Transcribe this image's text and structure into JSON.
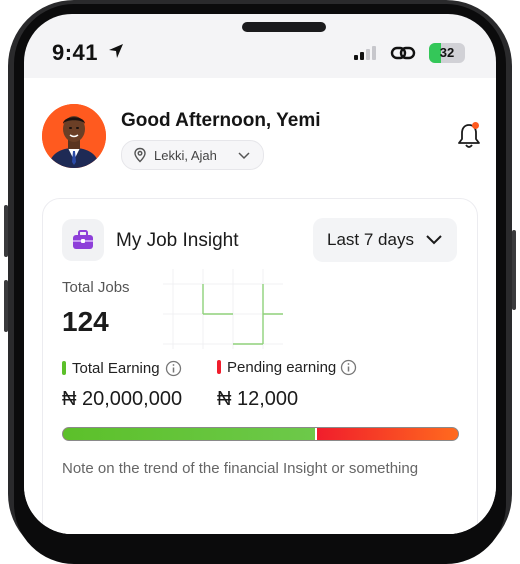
{
  "status_bar": {
    "time": "9:41",
    "battery": "32",
    "battery_level": 0.32
  },
  "header": {
    "greeting": "Good Afternoon, Yemi",
    "location": "Lekki, Ajah"
  },
  "job_insight": {
    "title": "My Job Insight",
    "period": "Last 7 days",
    "total_jobs_label": "Total Jobs",
    "total_jobs_value": "124",
    "total_earning_label": "Total Earning",
    "total_earning_value": "₦ 20,000,000",
    "pending_earning_label": "Pending earning",
    "pending_earning_value": "₦ 12,000",
    "earning_share": 0.64,
    "note": "Note on the trend of the financial Insight or something"
  },
  "colors": {
    "accent": "#ff5a1f",
    "earning_green": "#5cc02a",
    "pending_red": "#f01d2c",
    "purple_icon": "#8e3fd9"
  },
  "icons": {
    "location_arrow": "location-arrow-icon",
    "signal": "signal-icon",
    "link": "link-icon",
    "battery": "battery-icon",
    "pin": "map-pin-icon",
    "chevron": "chevron-down-icon",
    "bell": "bell-icon",
    "briefcase": "briefcase-icon",
    "info": "info-icon"
  }
}
